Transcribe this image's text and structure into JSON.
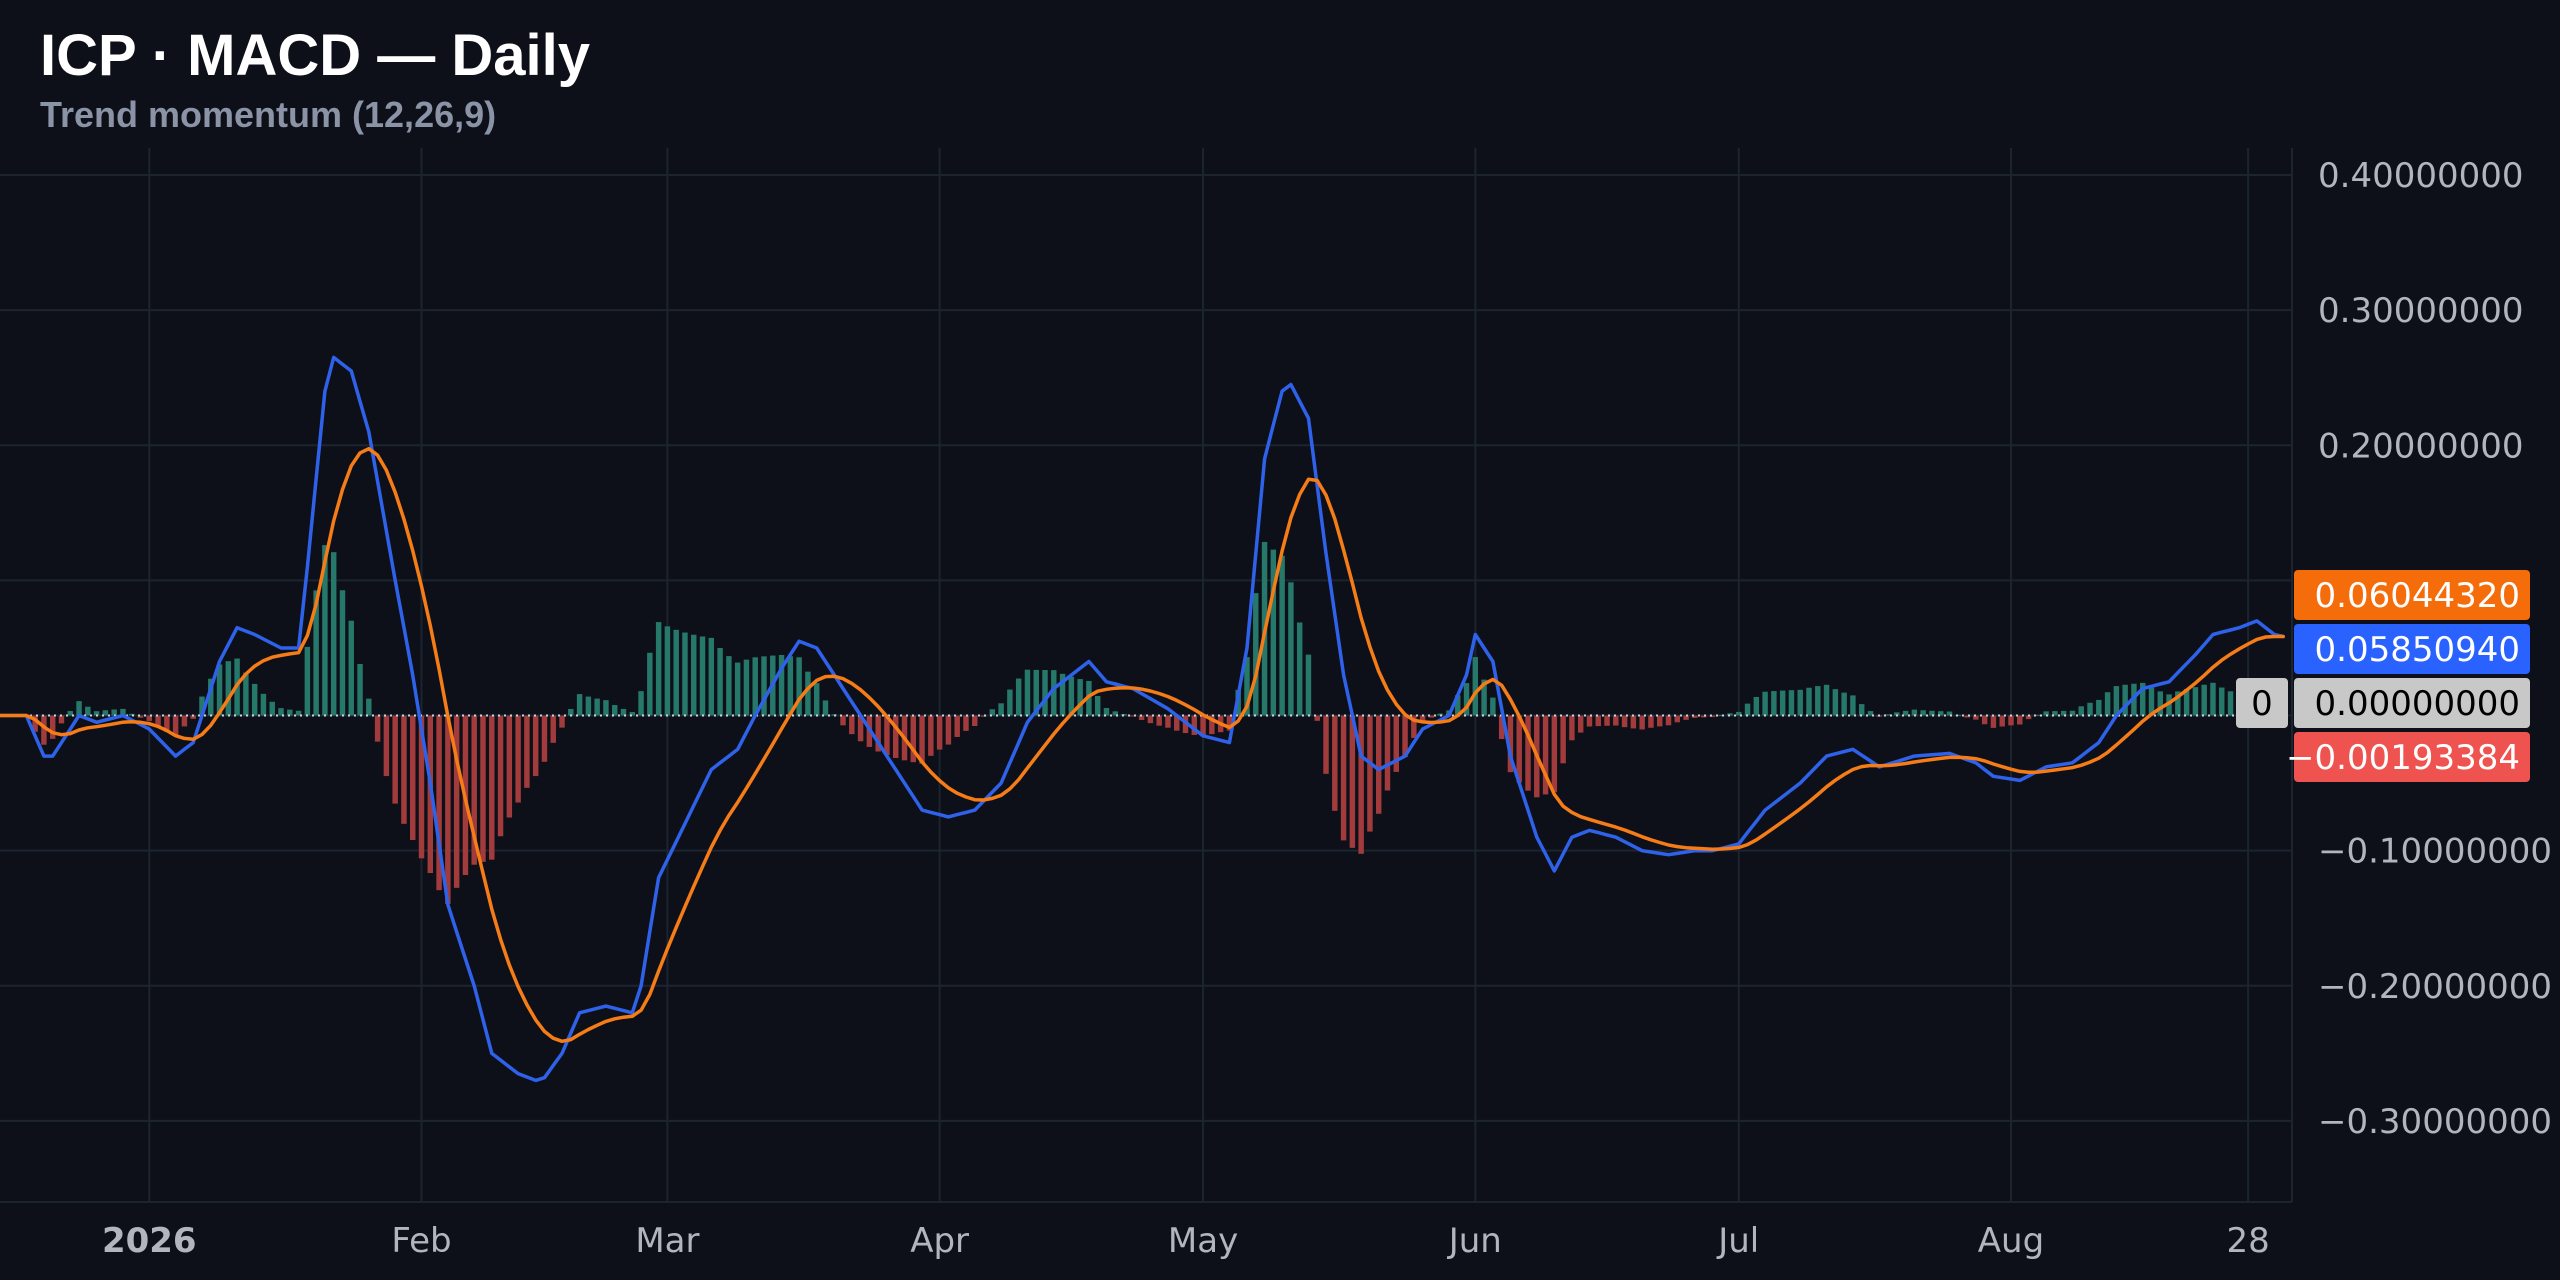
{
  "header": {
    "title": "ICP · MACD — Daily",
    "subtitle": "Trend momentum (12,26,9)"
  },
  "colors": {
    "background": "#0d1018",
    "grid": "#1c2430",
    "macd": "#2f62ea",
    "signal": "#f57c17",
    "hist_positive": "#26786a",
    "hist_negative": "#a23c3c",
    "tag_signal": "#f56c0a",
    "tag_macd": "#2962ff",
    "tag_zero": "#c8c8c8",
    "tag_hist": "#ef5350"
  },
  "chart_data": {
    "type": "line",
    "x_axis": {
      "ticks": [
        {
          "t": 8,
          "label": "2026",
          "bold": true
        },
        {
          "t": 39,
          "label": "Feb"
        },
        {
          "t": 67,
          "label": "Mar"
        },
        {
          "t": 98,
          "label": "Apr"
        },
        {
          "t": 128,
          "label": "May"
        },
        {
          "t": 159,
          "label": "Jun"
        },
        {
          "t": 189,
          "label": "Jul"
        },
        {
          "t": 220,
          "label": "Aug"
        },
        {
          "t": 247,
          "label": "28"
        }
      ]
    },
    "y_axis": {
      "ylim": [
        -0.36,
        0.42
      ],
      "ticks": [
        {
          "v": 0.4,
          "label": "0.40000000"
        },
        {
          "v": 0.3,
          "label": "0.30000000"
        },
        {
          "v": 0.2,
          "label": "0.20000000"
        },
        {
          "v": 0.1,
          "label": ""
        },
        {
          "v": 0.0,
          "label": ""
        },
        {
          "v": -0.1,
          "label": "−0.10000000"
        },
        {
          "v": -0.2,
          "label": "−0.20000000"
        },
        {
          "v": -0.3,
          "label": "−0.30000000"
        }
      ]
    },
    "macd_keypoints": [
      [
        -9,
        0.0
      ],
      [
        -6,
        0.0
      ],
      [
        -4,
        -0.03
      ],
      [
        -3,
        -0.03
      ],
      [
        0,
        0.0
      ],
      [
        2,
        -0.005
      ],
      [
        5,
        0.0
      ],
      [
        8,
        -0.01
      ],
      [
        11,
        -0.03
      ],
      [
        13,
        -0.02
      ],
      [
        16,
        0.04
      ],
      [
        18,
        0.065
      ],
      [
        20,
        0.06
      ],
      [
        23,
        0.05
      ],
      [
        25,
        0.05
      ],
      [
        26,
        0.11
      ],
      [
        28,
        0.24
      ],
      [
        29,
        0.265
      ],
      [
        31,
        0.255
      ],
      [
        33,
        0.21
      ],
      [
        36,
        0.1
      ],
      [
        38,
        0.03
      ],
      [
        40,
        -0.05
      ],
      [
        42,
        -0.14
      ],
      [
        45,
        -0.2
      ],
      [
        47,
        -0.25
      ],
      [
        50,
        -0.265
      ],
      [
        52,
        -0.27
      ],
      [
        53,
        -0.268
      ],
      [
        55,
        -0.25
      ],
      [
        57,
        -0.22
      ],
      [
        60,
        -0.215
      ],
      [
        63,
        -0.22
      ],
      [
        64,
        -0.2
      ],
      [
        66,
        -0.12
      ],
      [
        69,
        -0.08
      ],
      [
        72,
        -0.04
      ],
      [
        75,
        -0.025
      ],
      [
        77,
        0.0
      ],
      [
        80,
        0.035
      ],
      [
        82,
        0.055
      ],
      [
        84,
        0.05
      ],
      [
        87,
        0.02
      ],
      [
        90,
        -0.01
      ],
      [
        93,
        -0.04
      ],
      [
        96,
        -0.07
      ],
      [
        99,
        -0.075
      ],
      [
        102,
        -0.07
      ],
      [
        105,
        -0.05
      ],
      [
        108,
        -0.005
      ],
      [
        111,
        0.02
      ],
      [
        113,
        0.03
      ],
      [
        115,
        0.04
      ],
      [
        117,
        0.025
      ],
      [
        120,
        0.02
      ],
      [
        124,
        0.005
      ],
      [
        128,
        -0.015
      ],
      [
        131,
        -0.02
      ],
      [
        133,
        0.05
      ],
      [
        135,
        0.19
      ],
      [
        137,
        0.24
      ],
      [
        138,
        0.245
      ],
      [
        140,
        0.22
      ],
      [
        142,
        0.12
      ],
      [
        144,
        0.03
      ],
      [
        146,
        -0.03
      ],
      [
        148,
        -0.04
      ],
      [
        151,
        -0.03
      ],
      [
        153,
        -0.01
      ],
      [
        156,
        0.0
      ],
      [
        158,
        0.03
      ],
      [
        159,
        0.06
      ],
      [
        161,
        0.04
      ],
      [
        163,
        -0.03
      ],
      [
        166,
        -0.09
      ],
      [
        168,
        -0.115
      ],
      [
        170,
        -0.09
      ],
      [
        172,
        -0.085
      ],
      [
        175,
        -0.09
      ],
      [
        178,
        -0.1
      ],
      [
        181,
        -0.103
      ],
      [
        184,
        -0.1
      ],
      [
        186,
        -0.1
      ],
      [
        189,
        -0.095
      ],
      [
        192,
        -0.07
      ],
      [
        196,
        -0.05
      ],
      [
        199,
        -0.03
      ],
      [
        202,
        -0.025
      ],
      [
        205,
        -0.038
      ],
      [
        209,
        -0.03
      ],
      [
        213,
        -0.028
      ],
      [
        216,
        -0.035
      ],
      [
        218,
        -0.045
      ],
      [
        221,
        -0.048
      ],
      [
        224,
        -0.038
      ],
      [
        227,
        -0.035
      ],
      [
        230,
        -0.02
      ],
      [
        232,
        0.0
      ],
      [
        235,
        0.02
      ],
      [
        238,
        0.025
      ],
      [
        241,
        0.045
      ],
      [
        243,
        0.06
      ],
      [
        246,
        0.065
      ],
      [
        248,
        0.07
      ],
      [
        250,
        0.06
      ],
      [
        251,
        0.0585
      ]
    ],
    "signal_period": 9,
    "lines": [
      {
        "key": "macd",
        "color": "#2f62ea"
      },
      {
        "key": "signal",
        "color": "#f57c17"
      }
    ],
    "price_tags": [
      {
        "value": "0.06044320",
        "v": 0.0604432,
        "bg": "#f56c0a",
        "fg": "#ffffff"
      },
      {
        "value": "0.05850940",
        "v": 0.0585094,
        "bg": "#2962ff",
        "fg": "#ffffff"
      },
      {
        "value": "0.00000000",
        "v": 0.0,
        "bg": "#c8c8c8",
        "fg": "#000000",
        "prefix": "0"
      },
      {
        "value": "−0.00193384",
        "v": -0.00193384,
        "bg": "#ef5350",
        "fg": "#ffffff"
      }
    ]
  }
}
